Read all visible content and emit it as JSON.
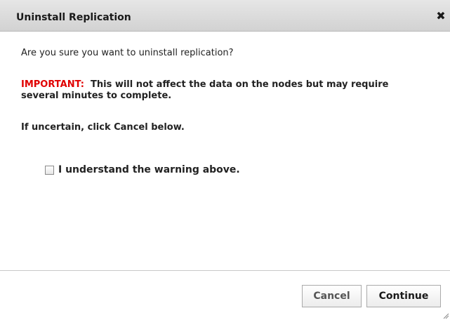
{
  "dialog": {
    "title": "Uninstall Replication",
    "close_glyph": "✖"
  },
  "content": {
    "question": "Are you sure you want to uninstall replication?",
    "important_lead": "IMPORTANT:",
    "important_text": "This will not affect the data on the nodes but may require several minutes to complete.",
    "uncertain": "If uncertain, click Cancel below.",
    "acknowledge_label": "I understand the warning above.",
    "acknowledge_checked": false
  },
  "footer": {
    "cancel_label": "Cancel",
    "continue_label": "Continue"
  },
  "colors": {
    "important": "#e00000",
    "titlebar": "#dcdcdc"
  },
  "icons": {
    "close": "close-icon",
    "resize": "resize-grip-icon"
  }
}
